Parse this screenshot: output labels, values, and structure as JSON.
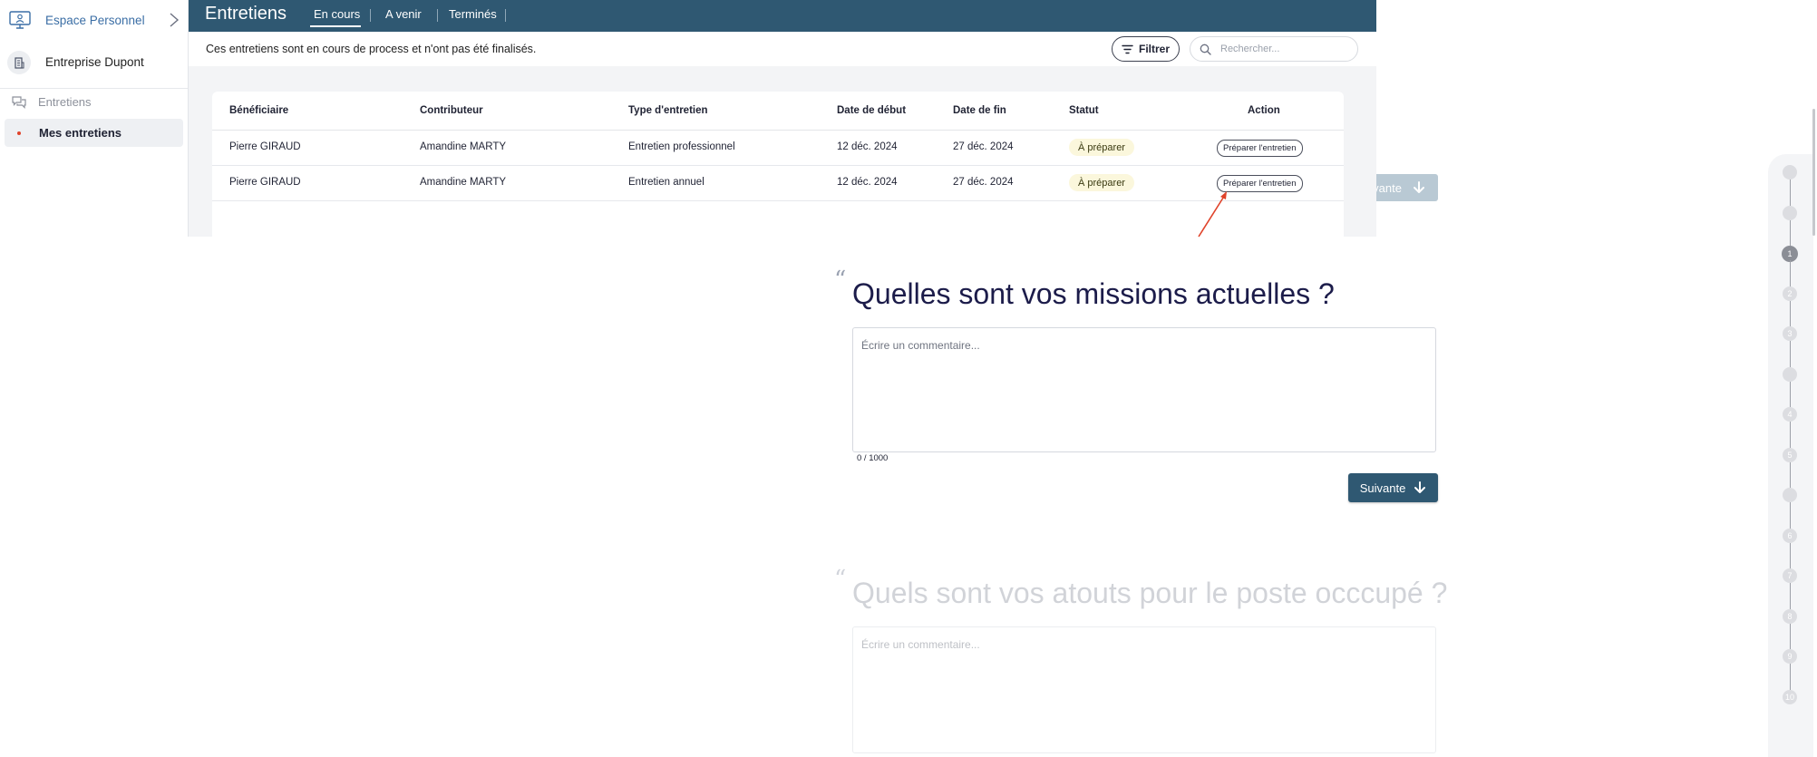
{
  "sidebar": {
    "personal_label": "Espace Personnel",
    "company_label": "Entreprise Dupont",
    "section_label": "Entretiens",
    "active_item_label": "Mes entretiens"
  },
  "header": {
    "title": "Entretiens",
    "tabs": [
      {
        "label": "En cours",
        "active": true
      },
      {
        "label": "A venir",
        "active": false
      },
      {
        "label": "Terminés",
        "active": false
      }
    ]
  },
  "subbar": {
    "description": "Ces entretiens sont en cours de process et n'ont pas été finalisés.",
    "filter_label": "Filtrer",
    "search_placeholder": "Rechercher..."
  },
  "table": {
    "columns": [
      "Bénéficiaire",
      "Contributeur",
      "Type d'entretien",
      "Date de début",
      "Date de fin",
      "Statut",
      "Action"
    ],
    "rows": [
      {
        "beneficiaire": "Pierre GIRAUD",
        "contributeur": "Amandine MARTY",
        "type": "Entretien professionnel",
        "debut": "12 déc. 2024",
        "fin": "27 déc. 2024",
        "statut": "À préparer",
        "action": "Préparer l'entretien"
      },
      {
        "beneficiaire": "Pierre GIRAUD",
        "contributeur": "Amandine MARTY",
        "type": "Entretien annuel",
        "debut": "12 déc. 2024",
        "fin": "27 déc. 2024",
        "statut": "À préparer",
        "action": "Préparer l'entretien"
      }
    ]
  },
  "questionnaire": {
    "ghost_next_label": "ivante",
    "questions": [
      {
        "title": "Quelles sont vos missions actuelles ?",
        "placeholder": "Écrire un commentaire...",
        "counter": "0 / 1000"
      },
      {
        "title": "Quels sont vos atouts pour le poste occcupé ?",
        "placeholder": "Écrire un commentaire..."
      }
    ],
    "next_label": "Suivante",
    "steps": [
      "",
      "",
      "1",
      "2",
      "3",
      "",
      "4",
      "5",
      "",
      "6",
      "7",
      "8",
      "9",
      "10"
    ]
  },
  "colors": {
    "topbar": "#2f5872",
    "accent_link": "#3b6ea5",
    "status_bg": "#fbf7dc",
    "arrow": "#e0432a",
    "active_dot": "#e0432a"
  },
  "icons": [
    "monitor-user-icon",
    "chevron-right-icon",
    "building-icon",
    "chat-bubbles-icon",
    "filter-icon",
    "search-icon",
    "arrow-down-icon",
    "annotation-arrow-icon"
  ]
}
